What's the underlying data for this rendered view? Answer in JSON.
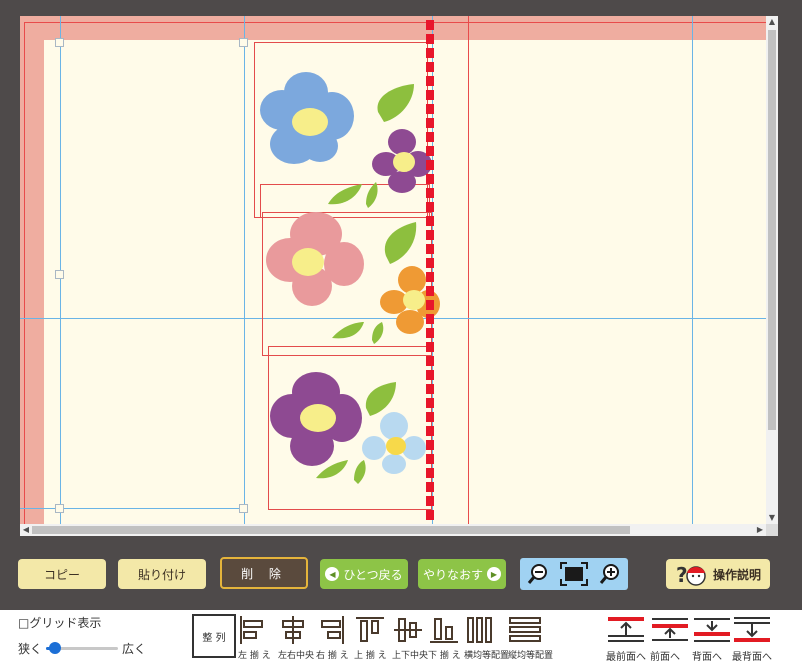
{
  "buttons": {
    "copy": "コピー",
    "paste": "貼り付け",
    "delete": "削 除",
    "undo": "ひとつ戻る",
    "redo": "やりなおす",
    "help": "操作説明"
  },
  "grid": {
    "checkbox_label": "□グリッド表示",
    "narrow_label": "狭く",
    "wide_label": "広く",
    "slider_value": 0.05
  },
  "align": {
    "button_label": "整 列",
    "items": [
      {
        "label": "左 揃 え",
        "icon": "align-left-icon"
      },
      {
        "label": "左右中央",
        "icon": "align-center-horizontal-icon"
      },
      {
        "label": "右 揃 え",
        "icon": "align-right-icon"
      },
      {
        "label": "上 揃 え",
        "icon": "align-top-icon"
      },
      {
        "label": "上下中央",
        "icon": "align-center-vertical-icon"
      },
      {
        "label": "下 揃 え",
        "icon": "align-bottom-icon"
      },
      {
        "label": "横均等配置",
        "icon": "distribute-horizontal-icon"
      },
      {
        "label": "縦均等配置",
        "icon": "distribute-vertical-icon"
      }
    ]
  },
  "layers": [
    {
      "label": "最前面へ",
      "icon": "bring-to-front-icon"
    },
    {
      "label": "前面へ",
      "icon": "bring-forward-icon"
    },
    {
      "label": "背面へ",
      "icon": "send-backward-icon"
    },
    {
      "label": "最背面へ",
      "icon": "send-to-back-icon"
    }
  ],
  "icons": {
    "zoom_out": "zoom-out-icon",
    "fit": "fit-screen-icon",
    "zoom_in": "zoom-in-icon",
    "help": "help-character-icon"
  },
  "colors": {
    "frame": "#4e4a4a",
    "canvas": "#fffbe9",
    "bleed": "#efada0",
    "guide": "#6ab4e6",
    "cut_line": "#e8162b",
    "button_yellow": "#f3e8a8",
    "button_green": "#8dc447",
    "delete_bg": "#5a4a3d",
    "delete_border": "#e5b43b",
    "zoom_panel": "#a0d2f2"
  }
}
